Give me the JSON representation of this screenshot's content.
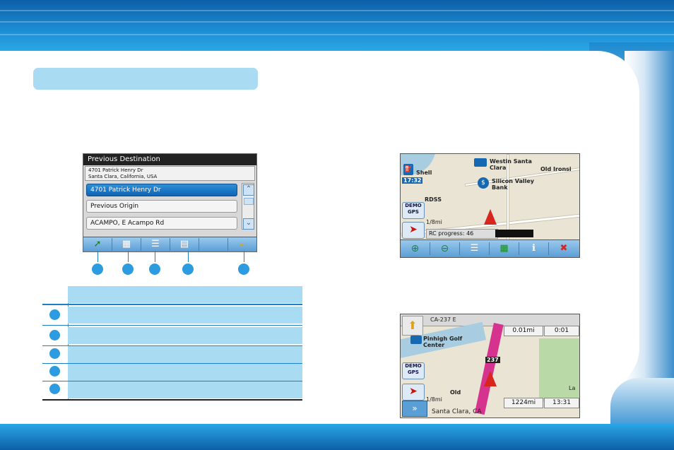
{
  "previous_destination_screen": {
    "header": "Previous Destination",
    "address_line1": "4701 Patrick Henry Dr",
    "address_line2": "Santa Clara, California, USA",
    "items": [
      "4701 Patrick Henry Dr",
      "Previous Origin",
      "ACAMPO, E Acampo Rd"
    ],
    "scroll_up_icon": "chevron-up",
    "scroll_down_icon": "chevron-down",
    "toolbar_icons": [
      "route-icon",
      "document-icon",
      "list-icon",
      "save-icon",
      "blank",
      "back-arrow-icon"
    ]
  },
  "map_screen_1": {
    "poi_shell": "Shell",
    "time": "17:32",
    "poi_hotel": "Westin Santa Clara",
    "street_old_ironsides": "Old Ironsi",
    "poi_bank": "Silicon Valley Bank",
    "street_ross": "RDSS",
    "scale": "1/8mi",
    "progress_label": "RC progress: 46",
    "demo_label": "DEMO",
    "gps_label": "GPS",
    "toolbar_icons": [
      "zoom-in-icon",
      "zoom-out-icon",
      "list-icon",
      "map-3d-icon",
      "info-pin-icon",
      "exit-icon"
    ]
  },
  "map_screen_2": {
    "road_header": "CA-237 E",
    "next_distance": "0.01mi",
    "next_time": "0:01",
    "poi_golf": "Pinhigh Golf Center",
    "highway_shield": "237",
    "street_old": "Old",
    "street_la": "La",
    "scale": "1/8mi",
    "total_distance": "1224mi",
    "clock": "13:31",
    "location": "Santa Clara, CA",
    "demo_label": "DEMO",
    "gps_label": "GPS"
  },
  "colors": {
    "accent_blue": "#2c9be0",
    "pill_blue": "#a9dbf3",
    "header_blue": "#1b8ad0",
    "route_pink": "#d6338f"
  }
}
